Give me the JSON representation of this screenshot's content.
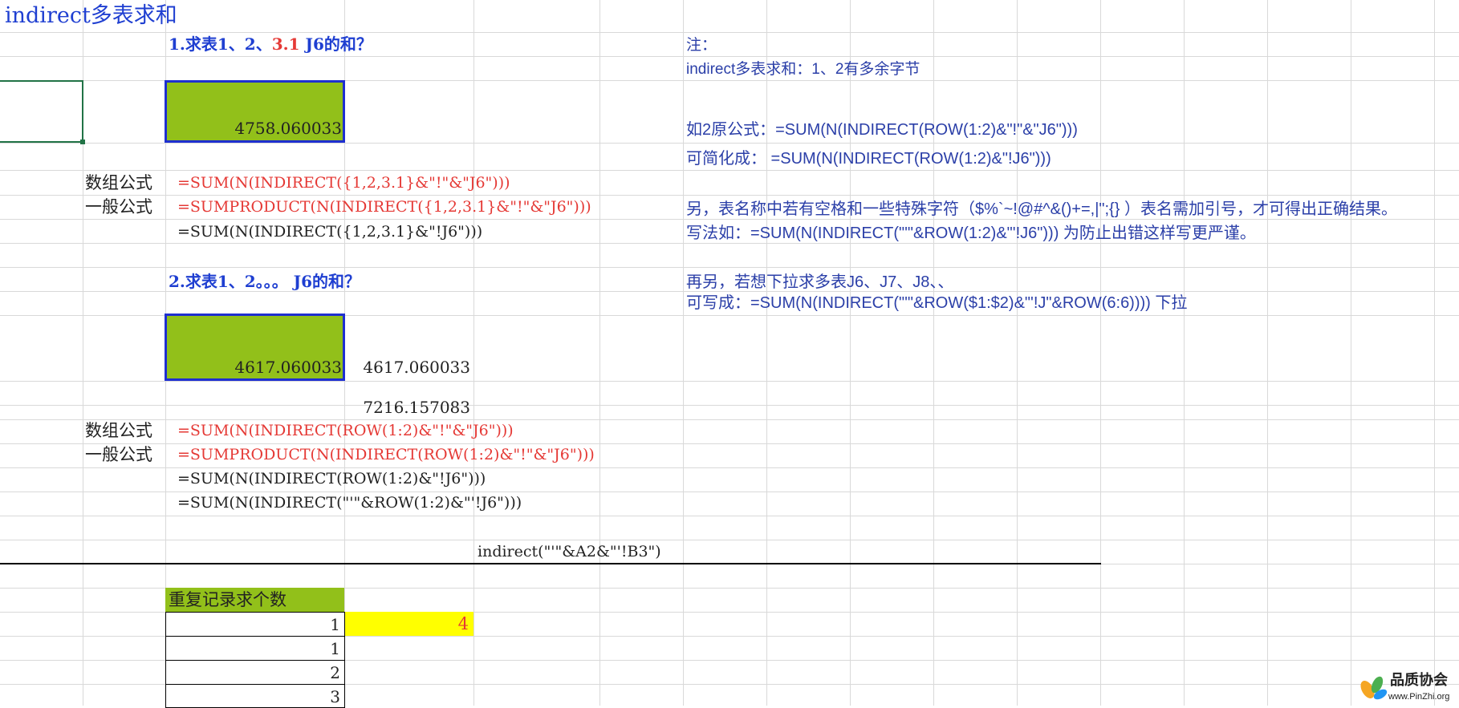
{
  "title": "indirect多表求和",
  "section1": {
    "heading_a": "1.求表1、2、",
    "heading_b": "3.1",
    "heading_c": " J6的和？",
    "result": "4758.060033",
    "label_array": "数组公式",
    "label_general": "一般公式",
    "formula1": "=SUM(N(INDIRECT({1,2,3.1}&\"!\"&\"J6\")))",
    "formula2": "=SUMPRODUCT(N(INDIRECT({1,2,3.1}&\"!\"&\"J6\")))",
    "formula3": "=SUM(N(INDIRECT({1,2,3.1}&\"!J6\")))"
  },
  "section2": {
    "heading": "2.求表1、2。。。 J6的和？",
    "result": "4617.060033",
    "side_value": "4617.060033",
    "side_value2": "7216.157083",
    "label_array": "数组公式",
    "label_general": "一般公式",
    "formula1": "=SUM(N(INDIRECT(ROW(1:2)&\"!\"&\"J6\")))",
    "formula2": "=SUMPRODUCT(N(INDIRECT(ROW(1:2)&\"!\"&\"J6\")))",
    "formula3": "=SUM(N(INDIRECT(ROW(1:2)&\"!J6\")))",
    "formula4": "=SUM(N(INDIRECT(\"'\"&ROW(1:2)&\"'!J6\")))"
  },
  "indirect_example": "indirect(\"'\"&A2&\"'!B3\")",
  "notes": {
    "n1": "注：",
    "n2": "indirect多表求和：1、2有多余字节",
    "n3": "如2原公式：=SUM(N(INDIRECT(ROW(1:2)&\"!\"&\"J6\")))",
    "n4": "可简化成： =SUM(N(INDIRECT(ROW(1:2)&\"!J6\")))",
    "n5": "另，表名称中若有空格和一些特殊字符（$%`~!@#^&()+=,|\";{} ）表名需加引号，才可得出正确结果。",
    "n6": "写法如：=SUM(N(INDIRECT(\"'\"&ROW(1:2)&\"'!J6\")))  为防止出错这样写更严谨。",
    "n7": "再另，若想下拉求多表J6、J7、J8、、",
    "n8": "可写成：=SUM(N(INDIRECT(\"'\"&ROW($1:$2)&\"'!J\"&ROW(6:6)))) 下拉"
  },
  "dup": {
    "header": "重复记录求个数",
    "values": [
      "1",
      "1",
      "2",
      "3"
    ],
    "count": "4"
  },
  "logo": {
    "name": "品质协会",
    "url": "www.PinZhi.org"
  }
}
